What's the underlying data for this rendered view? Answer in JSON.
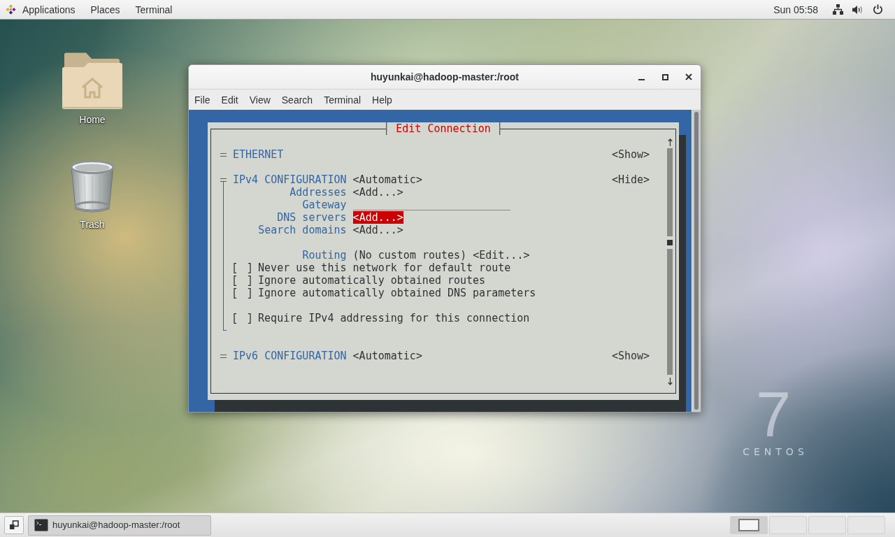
{
  "top_bar": {
    "menus": [
      {
        "label": "Applications",
        "kind": "applications"
      },
      {
        "label": "Places",
        "kind": "menu"
      },
      {
        "label": "Terminal",
        "kind": "menu"
      }
    ],
    "clock": "Sun 05:58"
  },
  "desktop": {
    "icons": [
      {
        "label": "Home",
        "kind": "home"
      },
      {
        "label": "Trash",
        "kind": "trash"
      }
    ],
    "logo": {
      "numeral": "7",
      "wordmark": "CENTOS"
    }
  },
  "terminal_window": {
    "title": "huyunkai@hadoop-master:/root",
    "menu": [
      "File",
      "Edit",
      "View",
      "Search",
      "Terminal",
      "Help"
    ],
    "dialog": {
      "title": "Edit Connection",
      "sections": [
        {
          "title": "ETHERNET",
          "toggle": "<Show>",
          "expanded": false
        },
        {
          "title": "IPv4 CONFIGURATION",
          "method": "<Automatic>",
          "toggle": "<Hide>",
          "expanded": true,
          "fields": [
            {
              "kind": "button",
              "label": "Addresses",
              "value": "<Add...>",
              "selected": false
            },
            {
              "kind": "input",
              "label": "Gateway",
              "selected": false
            },
            {
              "kind": "button",
              "label": "DNS servers",
              "value": "<Add...>",
              "selected": true
            },
            {
              "kind": "button",
              "label": "Search domains",
              "value": "<Add...>",
              "selected": false
            }
          ],
          "routing": {
            "label": "Routing",
            "summary": "(No custom routes)",
            "button": "<Edit...>"
          },
          "options": [
            {
              "label": "Never use this network for default route",
              "checked": false
            },
            {
              "label": "Ignore automatically obtained routes",
              "checked": false
            },
            {
              "label": "Ignore automatically obtained DNS parameters",
              "checked": false
            }
          ],
          "requirement": {
            "label": "Require IPv4 addressing for this connection",
            "checked": false
          }
        },
        {
          "title": "IPv6 CONFIGURATION",
          "method": "<Automatic>",
          "toggle": "<Show>",
          "expanded": false
        }
      ]
    }
  },
  "taskbar": {
    "windows": [
      {
        "title": "huyunkai@hadoop-master:/root",
        "selected": true
      }
    ],
    "workspaces": [
      {
        "selected": true,
        "has_window": true
      },
      {
        "selected": false,
        "has_window": false
      },
      {
        "selected": false,
        "has_window": false
      },
      {
        "selected": false,
        "has_window": false
      }
    ]
  }
}
